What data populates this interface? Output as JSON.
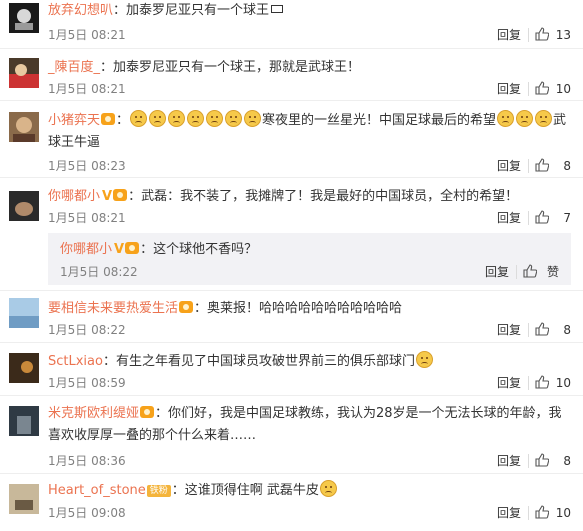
{
  "labels": {
    "reply": "回复",
    "like": "赞"
  },
  "comments": [
    {
      "id": 1,
      "user": "放弃幻想叭",
      "text": "：加泰罗尼亚只有一个球王",
      "time": "1月5日 08:21",
      "likes": "13"
    },
    {
      "id": 2,
      "user": "_陳百度_",
      "text": "：加泰罗尼亚只有一个球王，那就是武球王！",
      "time": "1月5日 08:21",
      "likes": "10"
    },
    {
      "id": 3,
      "user": "小猪弈天",
      "text_before": "：",
      "text_mid": "寒夜里的一丝星光！中国足球最后的希望",
      "text_after": "武球王牛逼",
      "time": "1月5日 08:23",
      "likes": "8"
    },
    {
      "id": 4,
      "user": "你哪都小",
      "text": "：武磊：我不装了，我摊牌了！我是最好的中国球员，全村的希望！",
      "time": "1月5日 08:21",
      "likes": "7",
      "reply": {
        "user": "你哪都小",
        "text": "：这个球他不香吗？",
        "time": "1月5日 08:22",
        "like_label": "赞"
      }
    },
    {
      "id": 5,
      "user": "要相信未来要热爱生活",
      "text": "：奥莱报！哈哈哈哈哈哈哈哈哈哈哈",
      "time": "1月5日 08:22",
      "likes": "8"
    },
    {
      "id": 6,
      "user": "SctLxiao",
      "text": "：有生之年看见了中国球员攻破世界前三的俱乐部球门",
      "time": "1月5日 08:59",
      "likes": "10"
    },
    {
      "id": 7,
      "user": "米克斯欧利缇娅",
      "text": "：你们好，我是中国足球教练，我认为28岁是一个无法长球的年龄，我喜欢收厚厚一叠的那个什么来着……",
      "time": "1月5日 08:36",
      "likes": "8"
    },
    {
      "id": 8,
      "user": "Heart_of_stone",
      "fan_badge": "铁粉",
      "text": "：这谁顶得住啊 武磊牛皮",
      "time": "1月5日 09:08",
      "likes": "10"
    }
  ],
  "colors": {
    "username": "#eb7350",
    "meta": "#808080",
    "badge": "#f7a21a",
    "quote_bg": "#f2f2f5"
  },
  "icons": {
    "like": "thumbs-up-icon",
    "emoji": "sad-face-emoji",
    "member": "member-badge-icon"
  }
}
